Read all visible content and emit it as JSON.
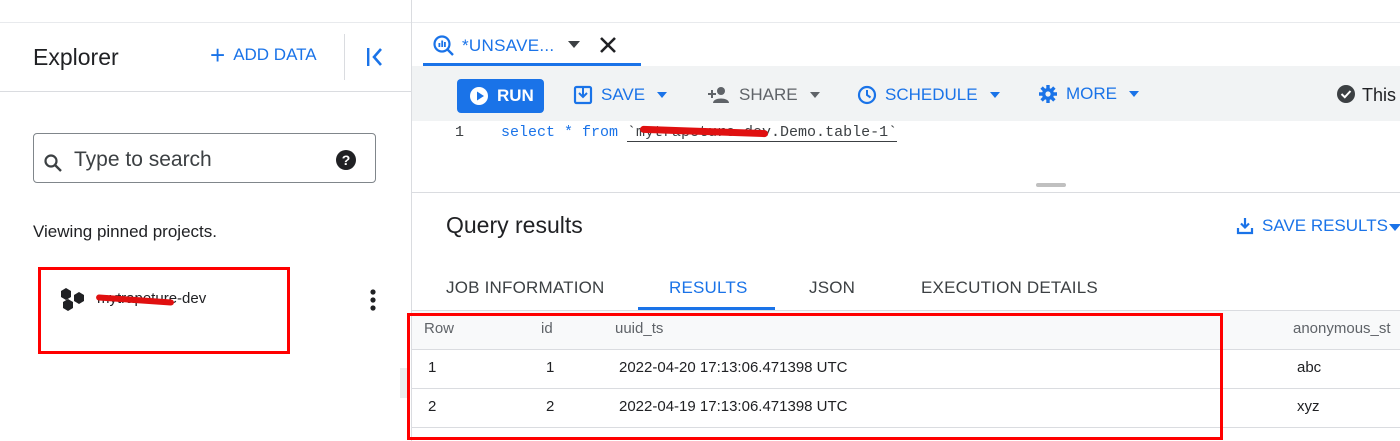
{
  "explorer": {
    "title": "Explorer",
    "add_data_label": "ADD DATA",
    "search_placeholder": "Type to search",
    "viewing_text": "Viewing pinned projects.",
    "project_name": "mytrapeture-dev"
  },
  "editor": {
    "tab_label": "*UNSAVE...",
    "toolbar": {
      "run_label": "RUN",
      "save_label": "SAVE",
      "share_label": "SHARE",
      "schedule_label": "SCHEDULE",
      "more_label": "MORE",
      "status_label": "This"
    },
    "code": {
      "line_number": "1",
      "keyword_text": "select * from ",
      "table_ref": "`mytrapeture-dev.Demo.table-1`"
    }
  },
  "results": {
    "title": "Query results",
    "save_results_label": "SAVE RESULTS",
    "tabs": [
      "JOB INFORMATION",
      "RESULTS",
      "JSON",
      "EXECUTION DETAILS"
    ],
    "active_tab": "RESULTS",
    "columns": [
      "Row",
      "id",
      "uuid_ts",
      "anonymous_st"
    ],
    "rows": [
      {
        "row": "1",
        "id": "1",
        "uuid_ts": "2022-04-20 17:13:06.471398 UTC",
        "anonymous": "abc"
      },
      {
        "row": "2",
        "id": "2",
        "uuid_ts": "2022-04-19 17:13:06.471398 UTC",
        "anonymous": "xyz"
      }
    ]
  },
  "colors": {
    "accent": "#1a73e8",
    "annotation_red": "#ff0000",
    "toolbar_bg": "#f1f3f4"
  }
}
